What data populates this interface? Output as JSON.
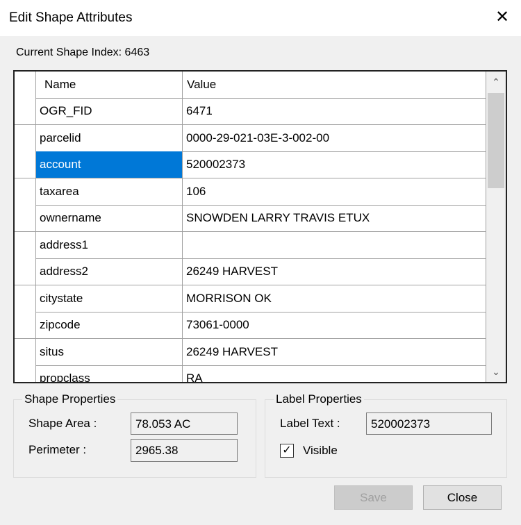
{
  "window": {
    "title": "Edit Shape Attributes",
    "close_glyph": "✕"
  },
  "current_index_label": "Current Shape Index: 6463",
  "grid": {
    "headers": {
      "name": "Name",
      "value": "Value"
    },
    "selected_row": 2,
    "rows": [
      {
        "name": "OGR_FID",
        "value": "6471"
      },
      {
        "name": "parcelid",
        "value": "0000-29-021-03E-3-002-00"
      },
      {
        "name": "account",
        "value": "520002373"
      },
      {
        "name": "taxarea",
        "value": "106"
      },
      {
        "name": "ownername",
        "value": "SNOWDEN LARRY TRAVIS ETUX"
      },
      {
        "name": "address1",
        "value": ""
      },
      {
        "name": "address2",
        "value": "26249 HARVEST"
      },
      {
        "name": "citystate",
        "value": "MORRISON OK"
      },
      {
        "name": "zipcode",
        "value": "73061-0000"
      },
      {
        "name": "situs",
        "value": "26249 HARVEST"
      },
      {
        "name": "propclass",
        "value": "RA"
      }
    ],
    "scroll_up": "⌃",
    "scroll_down": "⌄"
  },
  "shape_properties": {
    "title": "Shape Properties",
    "area_label": "Shape Area :",
    "area_value": "78.053 AC",
    "perimeter_label": "Perimeter :",
    "perimeter_value": "2965.38"
  },
  "label_properties": {
    "title": "Label Properties",
    "text_label": "Label Text :",
    "text_value": "520002373",
    "visible_label": "Visible",
    "visible_checked": true,
    "check_glyph": "✓"
  },
  "buttons": {
    "save": "Save",
    "close": "Close"
  }
}
